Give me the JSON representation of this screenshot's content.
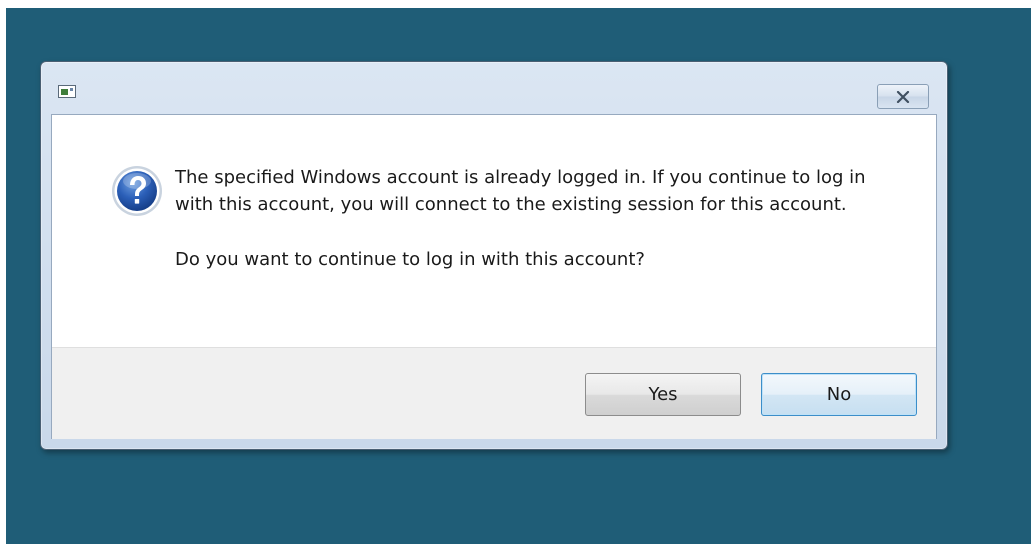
{
  "dialog": {
    "icon": "remote-desktop-app-icon",
    "close_icon": "close-icon",
    "message_icon": "question-icon",
    "message_line": "The specified Windows account is already logged in.  If you continue to log in with this account, you will connect to the existing session for this account.",
    "question": "Do you want to continue to log in with this account?",
    "buttons": {
      "yes_label": "Yes",
      "no_label": "No"
    },
    "default_button": "No"
  },
  "colors": {
    "desktop": "#1f5d77",
    "accent_focus": "#3c8ec9"
  }
}
